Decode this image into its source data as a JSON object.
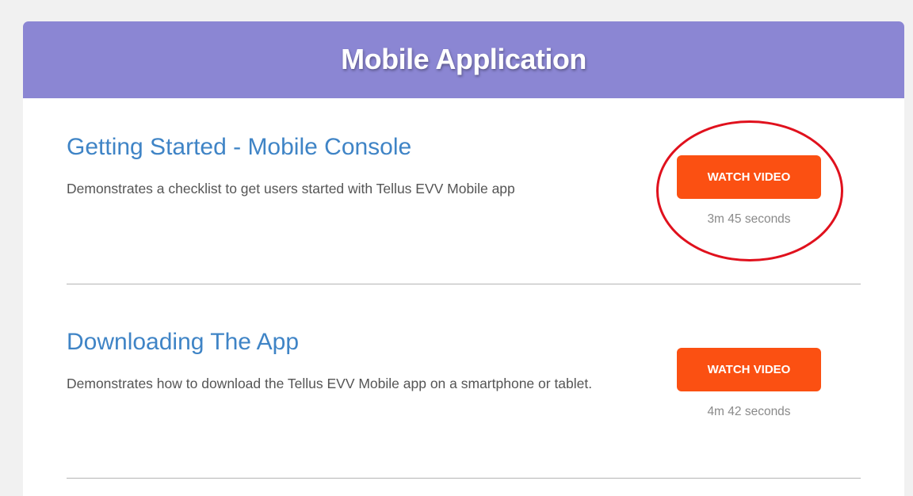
{
  "section": {
    "title": "Mobile Application"
  },
  "videos": [
    {
      "title": "Getting Started - Mobile Console",
      "description": "Demonstrates a checklist to get users started with Tellus EVV Mobile app",
      "button_label": "WATCH VIDEO",
      "duration": "3m 45 seconds"
    },
    {
      "title": "Downloading The App",
      "description": "Demonstrates how to download the Tellus EVV Mobile app on a smartphone or tablet.",
      "button_label": "WATCH VIDEO",
      "duration": "4m 42 seconds"
    }
  ],
  "colors": {
    "header_bg": "#8b86d3",
    "title_link": "#3f84c6",
    "button_bg": "#fb5012",
    "annotation": "#e0111d"
  }
}
